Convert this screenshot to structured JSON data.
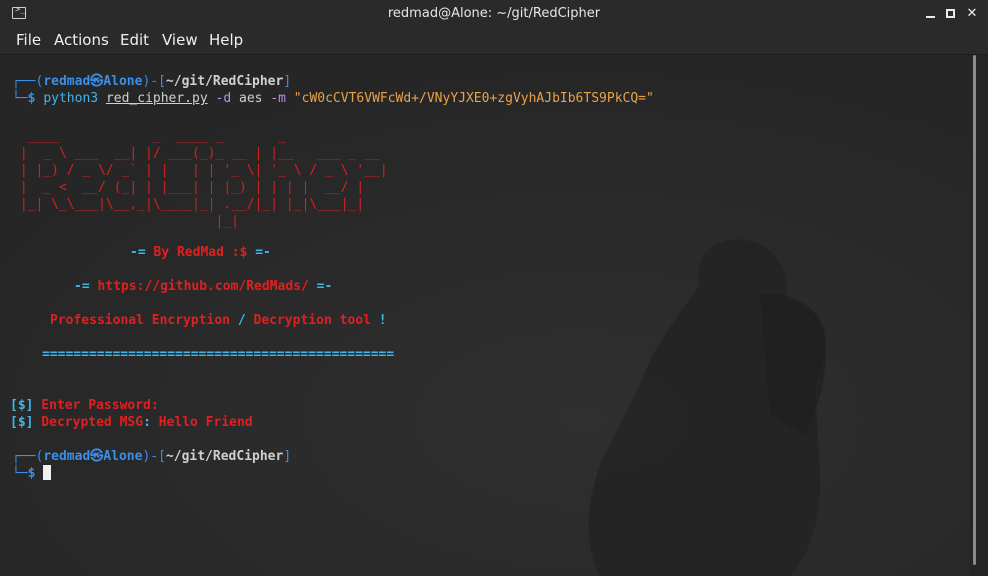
{
  "window": {
    "title": "redmad@Alone: ~/git/RedCipher",
    "controls": {
      "minimize": "minimize",
      "maximize": "maximize",
      "close": "✕"
    }
  },
  "menu": [
    "File",
    "Actions",
    "Edit",
    "View",
    "Help"
  ],
  "prompt1": {
    "user": "redmad",
    "at": "㉿",
    "host": "Alone",
    "path": "~/git/RedCipher",
    "cmd": "python3",
    "script": "red_cipher.py",
    "flag_d": "-d",
    "algo": "aes",
    "flag_m": "-m",
    "message": "\"cW0cCVT6VWFcWd+/VNyYJXE0+zgVyhAJbIb6TS9PkCQ=\""
  },
  "banner": {
    "art": [
      "  ____            _  ____ _       _",
      " |  _ \\ ___  __| |/ ___(_)_ __ | |__   ___ _ __",
      " | |_) / _ \\/ _` | |   | | '_ \\| '_ \\ / _ \\ '__|",
      " |  _ <  __/ (_| | |___| | |_) | | | |  __/ |",
      " |_| \\_\\___|\\__,_|\\____|_| .__/|_| |_|\\___|_|",
      "                          |_|"
    ],
    "by_prefix": "-= ",
    "by": "By RedMad :$",
    "by_suffix": " =-",
    "url_prefix": "-= ",
    "url": "https://github.com/RedMads/",
    "url_suffix": " =-",
    "tagline_a": "Professional Encryption ",
    "tagline_slash": "/",
    "tagline_b": " Decryption tool ",
    "tagline_bang": "!",
    "divider": "============================================="
  },
  "output": {
    "enter_tag": "[$]",
    "enter_label": " Enter Password:",
    "dec_tag": "[$]",
    "dec_label": " Decrypted MSG",
    "dec_sep": ": ",
    "dec_value": "Hello Friend"
  },
  "prompt2": {
    "user": "redmad",
    "at": "㉿",
    "host": "Alone",
    "path": "~/git/RedCipher",
    "dollar": "$"
  }
}
